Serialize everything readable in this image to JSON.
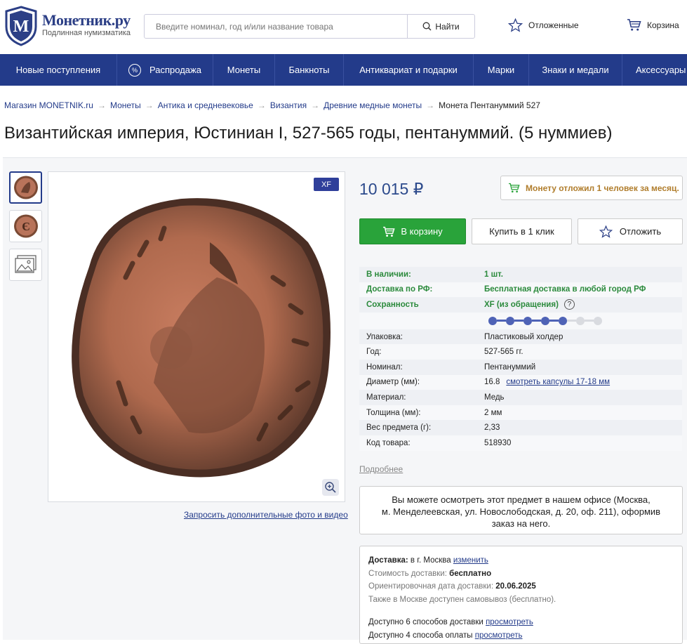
{
  "header": {
    "logo_title": "Монетник.ру",
    "logo_subtitle": "Подлинная нумизматика",
    "search_placeholder": "Введите номинал, год и/или название товара",
    "search_button": "Найти",
    "wishlist_label": "Отложенные",
    "cart_label": "Корзина"
  },
  "nav": {
    "items": [
      {
        "label": "Новые поступления"
      },
      {
        "label": "Распродажа",
        "icon": "percent-icon"
      },
      {
        "label": "Монеты"
      },
      {
        "label": "Банкноты"
      },
      {
        "label": "Антиквариат и подарки"
      },
      {
        "label": "Марки"
      },
      {
        "label": "Знаки и медали"
      },
      {
        "label": "Аксессуары"
      }
    ]
  },
  "breadcrumb": {
    "items": [
      "Магазин MONETNIK.ru",
      "Монеты",
      "Антика и средневековье",
      "Византия",
      "Древние медные монеты"
    ],
    "current": "Монета Пентануммий 527"
  },
  "product": {
    "title": "Византийская империя, Юстиниан I, 527-565 годы, пентануммий. (5 нуммиев)",
    "grade_badge": "XF",
    "price": "10 015 ₽",
    "reserved_note": "Монету отложил 1 человек за месяц.",
    "add_to_cart": "В корзину",
    "buy_one_click": "Купить в 1 клик",
    "defer": "Отложить",
    "request_media": "Запросить дополнительные фото и видео",
    "more_link": "Подробнее",
    "grade_level": 5,
    "grade_total": 7
  },
  "specs": {
    "availability": {
      "k": "В наличии:",
      "v": "1 шт."
    },
    "delivery": {
      "k": "Доставка по РФ:",
      "v": "Бесплатная доставка в любой город РФ"
    },
    "condition": {
      "k": "Сохранность",
      "v": "XF (из обращения)",
      "help": "?"
    },
    "rows": [
      {
        "k": "Упаковка:",
        "v": "Пластиковый холдер"
      },
      {
        "k": "Год:",
        "v": "527-565 гг."
      },
      {
        "k": "Номинал:",
        "v": "Пентануммий"
      },
      {
        "k": "Диаметр (мм):",
        "v": "16.8",
        "link": "смотреть капсулы 17-18 мм"
      },
      {
        "k": "Материал:",
        "v": "Медь"
      },
      {
        "k": "Толщина (мм):",
        "v": "2 мм"
      },
      {
        "k": "Вес предмета (г):",
        "v": "2,33"
      },
      {
        "k": "Код товара:",
        "v": "518930"
      }
    ]
  },
  "office": {
    "line1": "Вы можете осмотреть этот предмет в нашем офисе (Москва,",
    "line2": "м. Менделеевская, ул. Новослободская, д. 20, оф. 211), оформив",
    "line3": "заказ на него."
  },
  "delivery": {
    "label": "Доставка:",
    "city": "в г. Москва",
    "change": "изменить",
    "cost_label": "Стоимость доставки:",
    "cost_value": "бесплатно",
    "date_label": "Ориентировочная дата доставки:",
    "date_value": "20.06.2025",
    "pickup_note": "Также в Москве доступен самовывоз (бесплатно).",
    "methods": "Доступно 6 способов доставки",
    "methods_link": "просмотреть",
    "payments": "Доступно 4 способа оплаты",
    "payments_link": "просмотреть"
  },
  "colors": {
    "brand_blue": "#233b8a",
    "price_blue": "#2c4a8c",
    "green": "#29a33a",
    "reserved": "#b07d2c"
  }
}
